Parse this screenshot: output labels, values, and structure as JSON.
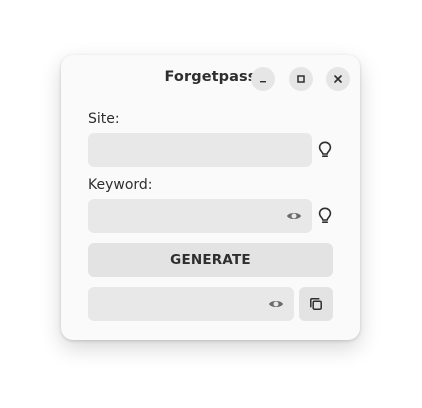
{
  "window": {
    "title": "Forgetpass",
    "controls": {
      "minimize_icon": "minimize-icon",
      "maximize_icon": "maximize-icon",
      "close_icon": "close-icon"
    }
  },
  "form": {
    "site": {
      "label": "Site:",
      "value": "",
      "hint_icon": "lightbulb-icon"
    },
    "keyword": {
      "label": "Keyword:",
      "value": "",
      "reveal_icon": "eye-icon",
      "hint_icon": "lightbulb-icon"
    },
    "generate_label": "GENERATE",
    "result": {
      "value": "",
      "reveal_icon": "eye-icon",
      "copy_icon": "copy-icon"
    }
  },
  "colors": {
    "window_bg": "#fafafa",
    "entry_bg": "#e8e8e8",
    "button_bg": "#e3e3e3",
    "text": "#2e2e2e",
    "icon": "#2e2e2e",
    "muted_icon": "#6b6b6b"
  }
}
